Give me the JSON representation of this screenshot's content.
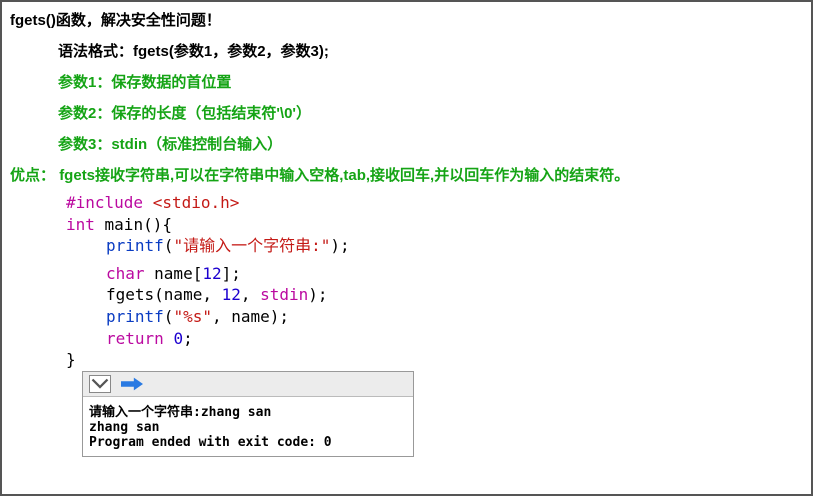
{
  "header": "fgets()函数，解决安全性问题！",
  "syntax_label": "语法格式：",
  "syntax_code": "fgets(参数1，参数2，参数3);",
  "params": {
    "p1": "参数1：保存数据的首位置",
    "p2": "参数2：保存的长度（包括结束符'\\0'）",
    "p3": "参数3：stdin（标准控制台输入）"
  },
  "advantage_label": "优点：",
  "advantage_text": "fgets接收字符串,可以在字符串中输入空格,tab,接收回车,并以回车作为输入的结束符。",
  "code": {
    "l1a": "#include ",
    "l1b": "<stdio.h>",
    "l2a": "int",
    "l2b": " main(){",
    "l3a": "printf",
    "l3b": "(",
    "l3c": "\"请输入一个字符串:\"",
    "l3d": ");",
    "l4a": "char",
    "l4b": " name[",
    "l4c": "12",
    "l4d": "];",
    "l5a": "fgets(name, ",
    "l5b": "12",
    "l5c": ", ",
    "l5d": "stdin",
    "l5e": ");",
    "l6a": "printf",
    "l6b": "(",
    "l6c": "\"%s\"",
    "l6d": ", name);",
    "l7a": "return",
    "l7b": " ",
    "l7c": "0",
    "l7d": ";",
    "l8": "}"
  },
  "console": {
    "line1": "请输入一个字符串:zhang san",
    "line2": "zhang san",
    "line3": "Program ended with exit code: 0"
  }
}
